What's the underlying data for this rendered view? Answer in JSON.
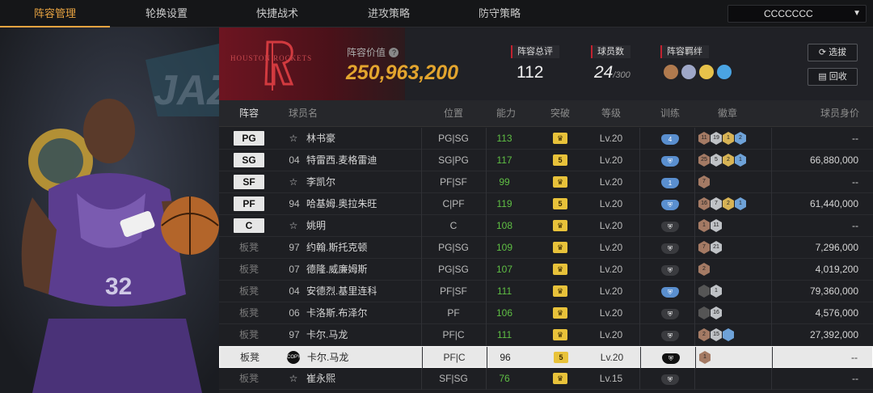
{
  "nav": {
    "tabs": [
      "阵容管理",
      "轮换设置",
      "快捷战术",
      "进攻策略",
      "防守策略"
    ],
    "active": 0,
    "user": "CCCCCCC"
  },
  "brand": {
    "logo_text": "HOUSTON ROCKETS"
  },
  "summary": {
    "value_label": "阵容价值",
    "value": "250,963,200",
    "rating_label": "阵容总评",
    "rating": "112",
    "players_label": "球员数",
    "players": "24",
    "players_max": "/300",
    "synergy_label": "阵容羁绊"
  },
  "buttons": {
    "pick": "选拔",
    "recycle": "回收"
  },
  "columns": [
    "阵容",
    "球员名",
    "位置",
    "能力",
    "突破",
    "等级",
    "训练",
    "徽章",
    "球员身价"
  ],
  "rows": [
    {
      "slot": "PG",
      "starter": true,
      "num": "",
      "star": true,
      "name": "林书豪",
      "pos": "PG|SG",
      "ability": "113",
      "breakthrough": "",
      "level": "Lv.20",
      "train": "4",
      "train_type": "b",
      "badges": [
        [
          "11",
          "hb"
        ],
        [
          "19",
          "hs"
        ],
        [
          "1",
          "hg"
        ],
        [
          "2",
          "hd"
        ]
      ],
      "value": "--"
    },
    {
      "slot": "SG",
      "starter": true,
      "num": "04",
      "star": false,
      "name": "特雷西.麦格雷迪",
      "pos": "SG|PG",
      "ability": "117",
      "breakthrough": "5",
      "level": "Lv.20",
      "train": "",
      "train_type": "b",
      "badges": [
        [
          "25",
          "hb"
        ],
        [
          "5",
          "hs"
        ],
        [
          "2",
          "hg"
        ],
        [
          "1",
          "hd"
        ]
      ],
      "value": "66,880,000"
    },
    {
      "slot": "SF",
      "starter": true,
      "num": "",
      "star": true,
      "name": "李凯尔",
      "pos": "PF|SF",
      "ability": "99",
      "breakthrough": "",
      "level": "Lv.20",
      "train": "1",
      "train_type": "b",
      "badges": [
        [
          "7",
          "hb"
        ]
      ],
      "value": "--"
    },
    {
      "slot": "PF",
      "starter": true,
      "num": "94",
      "star": false,
      "name": "哈基姆.奥拉朱旺",
      "pos": "C|PF",
      "ability": "119",
      "breakthrough": "5",
      "level": "Lv.20",
      "train": "",
      "train_type": "b",
      "badges": [
        [
          "16",
          "hb"
        ],
        [
          "7",
          "hs"
        ],
        [
          "2",
          "hg"
        ],
        [
          "1",
          "hd"
        ]
      ],
      "value": "61,440,000"
    },
    {
      "slot": "C",
      "starter": true,
      "num": "",
      "star": true,
      "name": "姚明",
      "pos": "C",
      "ability": "108",
      "breakthrough": "",
      "level": "Lv.20",
      "train": "",
      "train_type": "g",
      "badges": [
        [
          "1",
          "hb"
        ],
        [
          "11",
          "hs"
        ]
      ],
      "value": "--"
    },
    {
      "slot": "板凳",
      "starter": false,
      "num": "97",
      "star": false,
      "name": "约翰.斯托克顿",
      "pos": "PG|SG",
      "ability": "109",
      "breakthrough": "",
      "level": "Lv.20",
      "train": "",
      "train_type": "g",
      "badges": [
        [
          "7",
          "hb"
        ],
        [
          "21",
          "hs"
        ]
      ],
      "value": "7,296,000"
    },
    {
      "slot": "板凳",
      "starter": false,
      "num": "07",
      "star": false,
      "name": "德隆.威廉姆斯",
      "pos": "PG|SG",
      "ability": "107",
      "breakthrough": "",
      "level": "Lv.20",
      "train": "",
      "train_type": "g",
      "badges": [
        [
          "2",
          "hb"
        ]
      ],
      "value": "4,019,200"
    },
    {
      "slot": "板凳",
      "starter": false,
      "num": "04",
      "star": false,
      "name": "安德烈.基里连科",
      "pos": "PF|SF",
      "ability": "111",
      "breakthrough": "",
      "level": "Lv.20",
      "train": "",
      "train_type": "b",
      "badges": [
        [
          "",
          "hk"
        ],
        [
          "1",
          "hs"
        ]
      ],
      "value": "79,360,000"
    },
    {
      "slot": "板凳",
      "starter": false,
      "num": "06",
      "star": false,
      "name": "卡洛斯.布泽尔",
      "pos": "PF",
      "ability": "106",
      "breakthrough": "",
      "level": "Lv.20",
      "train": "",
      "train_type": "g",
      "badges": [
        [
          "",
          "hk"
        ],
        [
          "16",
          "hs"
        ]
      ],
      "value": "4,576,000"
    },
    {
      "slot": "板凳",
      "starter": false,
      "num": "97",
      "star": false,
      "name": "卡尔.马龙",
      "pos": "PF|C",
      "ability": "111",
      "breakthrough": "",
      "level": "Lv.20",
      "train": "",
      "train_type": "g",
      "badges": [
        [
          "2",
          "hb"
        ],
        [
          "15",
          "hs"
        ],
        [
          "",
          "hd"
        ]
      ],
      "value": "27,392,000"
    },
    {
      "slot": "板凳",
      "starter": false,
      "num": "",
      "star": false,
      "copy": true,
      "name": "卡尔.马龙",
      "pos": "PF|C",
      "ability": "96",
      "breakthrough": "5",
      "level": "Lv.20",
      "train": "",
      "train_type": "d",
      "badges": [
        [
          "1",
          "hb"
        ]
      ],
      "value": "--",
      "selected": true
    },
    {
      "slot": "板凳",
      "starter": false,
      "num": "",
      "star": true,
      "name": "崔永熙",
      "pos": "SF|SG",
      "ability": "76",
      "breakthrough": "",
      "level": "Lv.15",
      "train": "",
      "train_type": "g",
      "badges": [],
      "value": "--"
    }
  ],
  "copy_tag": "COPY",
  "player_art": {
    "jersey_text": "JAZZ",
    "jersey_number": "32"
  }
}
